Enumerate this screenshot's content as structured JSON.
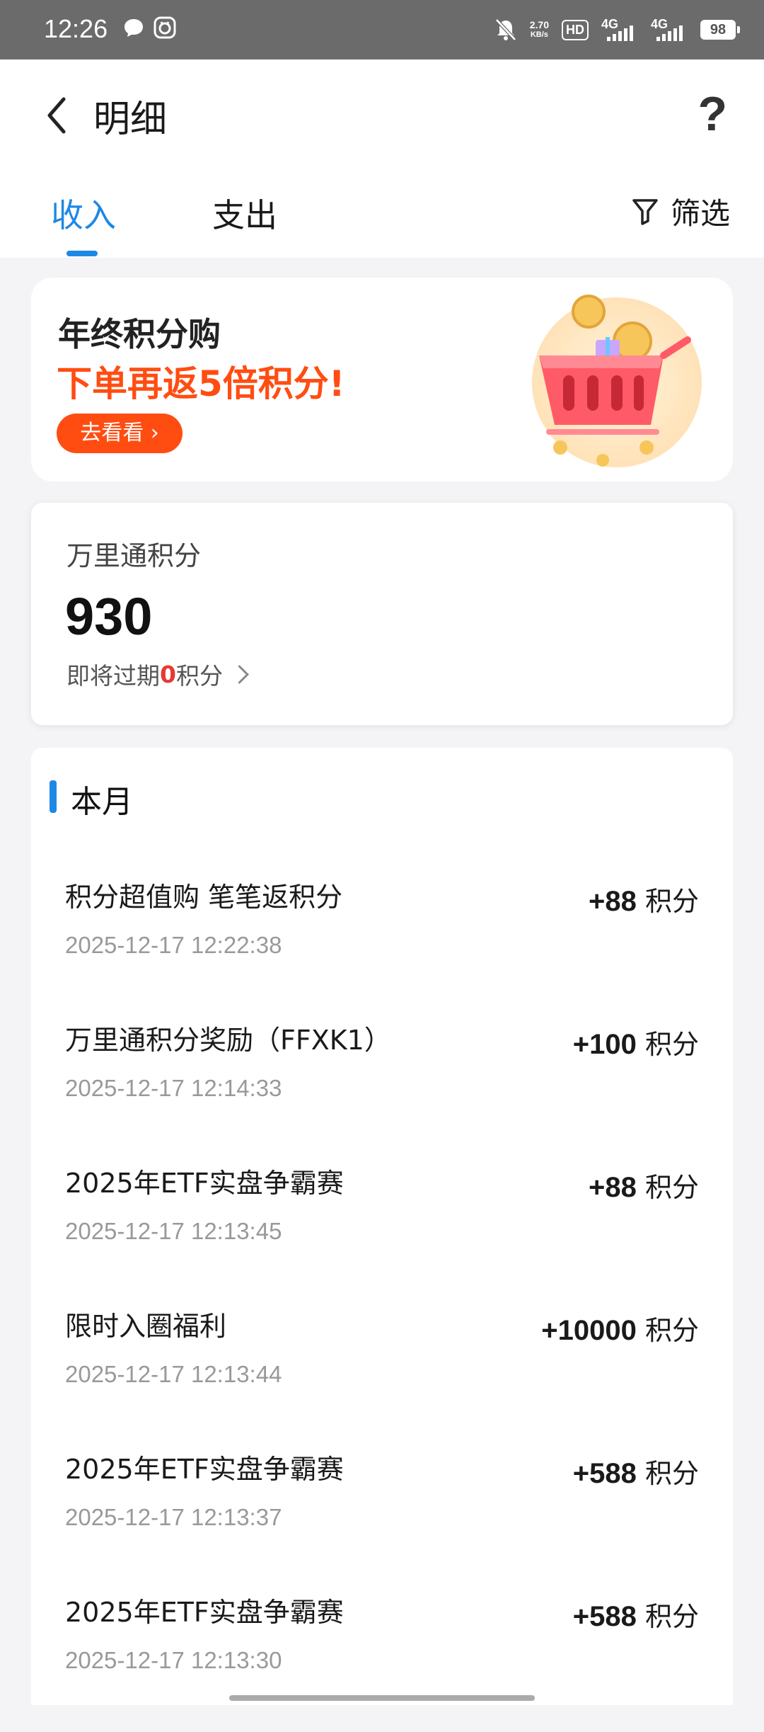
{
  "status_bar": {
    "time": "12:26",
    "speed_value": "2.70",
    "speed_unit": "KB/s",
    "hd": "HD",
    "net1": "4G",
    "net2": "4G",
    "battery": "98"
  },
  "header": {
    "title": "明细",
    "help": "?",
    "tabs": [
      {
        "label": "收入"
      },
      {
        "label": "支出"
      }
    ],
    "filter_label": "筛选"
  },
  "promo": {
    "title": "年终积分购",
    "subtitle": "下单再返5倍积分!",
    "button": "去看看 ›"
  },
  "points": {
    "label": "万里通积分",
    "value": "930",
    "expire_prefix": "即将过期",
    "expire_value": "0",
    "expire_suffix": "积分"
  },
  "list": {
    "month": "本月",
    "unit": "积分",
    "items": [
      {
        "title": "积分超值购 笔笔返积分",
        "time": "2025-12-17 12:22:38",
        "amount": "+88"
      },
      {
        "title": "万里通积分奖励（FFXK1）",
        "time": "2025-12-17 12:14:33",
        "amount": "+100"
      },
      {
        "title": "2025年ETF实盘争霸赛",
        "time": "2025-12-17 12:13:45",
        "amount": "+88"
      },
      {
        "title": "限时入圈福利",
        "time": "2025-12-17 12:13:44",
        "amount": "+10000"
      },
      {
        "title": "2025年ETF实盘争霸赛",
        "time": "2025-12-17 12:13:37",
        "amount": "+588"
      },
      {
        "title": "2025年ETF实盘争霸赛",
        "time": "2025-12-17 12:13:30",
        "amount": "+588"
      }
    ]
  },
  "colors": {
    "accent": "#1e88e5",
    "promo_orange": "#ff4d12",
    "expire_red": "#e53935",
    "statusbar": "#6b6b6b"
  }
}
